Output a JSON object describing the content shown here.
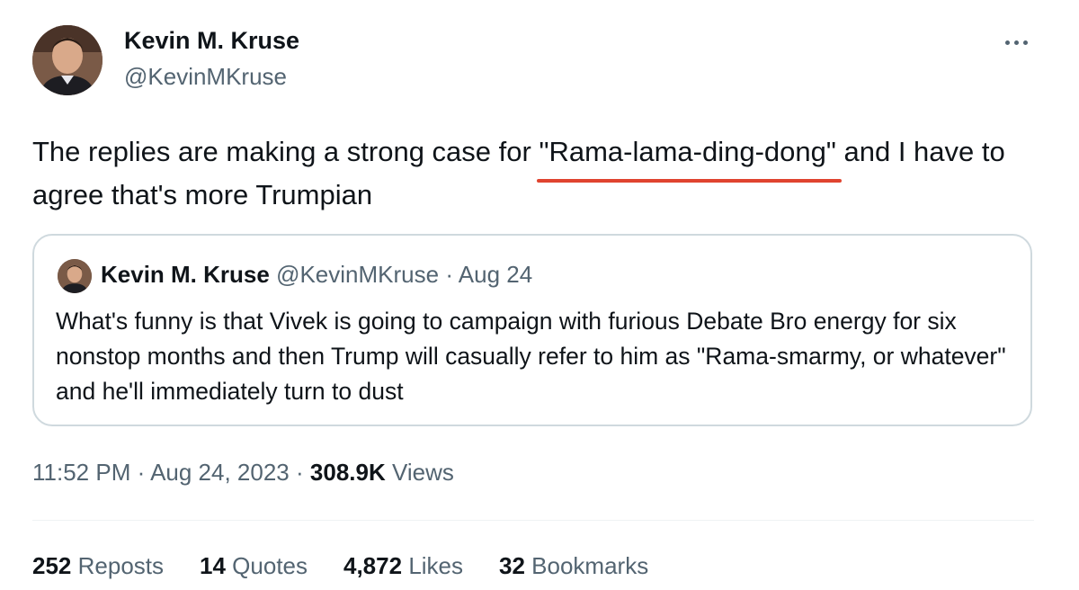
{
  "author": {
    "name": "Kevin M. Kruse",
    "handle": "@KevinMKruse"
  },
  "tweet": {
    "text_before": "The replies are making a strong case for ",
    "text_highlight": "\"Rama-lama-ding-dong\"",
    "text_after": " and I have to agree that's more Trumpian"
  },
  "quote": {
    "name": "Kevin M. Kruse",
    "handle": "@KevinMKruse",
    "separator": "·",
    "date": "Aug 24",
    "text": "What's funny is that Vivek is going to campaign with furious Debate Bro energy for six nonstop months and then Trump will casually refer to him as \"Rama-smarmy, or whatever\" and he'll immediately turn to dust"
  },
  "meta": {
    "time": "11:52 PM",
    "separator": "·",
    "date": "Aug 24, 2023",
    "views_count": "308.9K",
    "views_label": "Views"
  },
  "stats": {
    "reposts_count": "252",
    "reposts_label": "Reposts",
    "quotes_count": "14",
    "quotes_label": "Quotes",
    "likes_count": "4,872",
    "likes_label": "Likes",
    "bookmarks_count": "32",
    "bookmarks_label": "Bookmarks"
  },
  "colors": {
    "text_primary": "#0f1419",
    "text_secondary": "#536471",
    "underline_accent": "#e0442f",
    "card_border": "#cfd9de"
  }
}
